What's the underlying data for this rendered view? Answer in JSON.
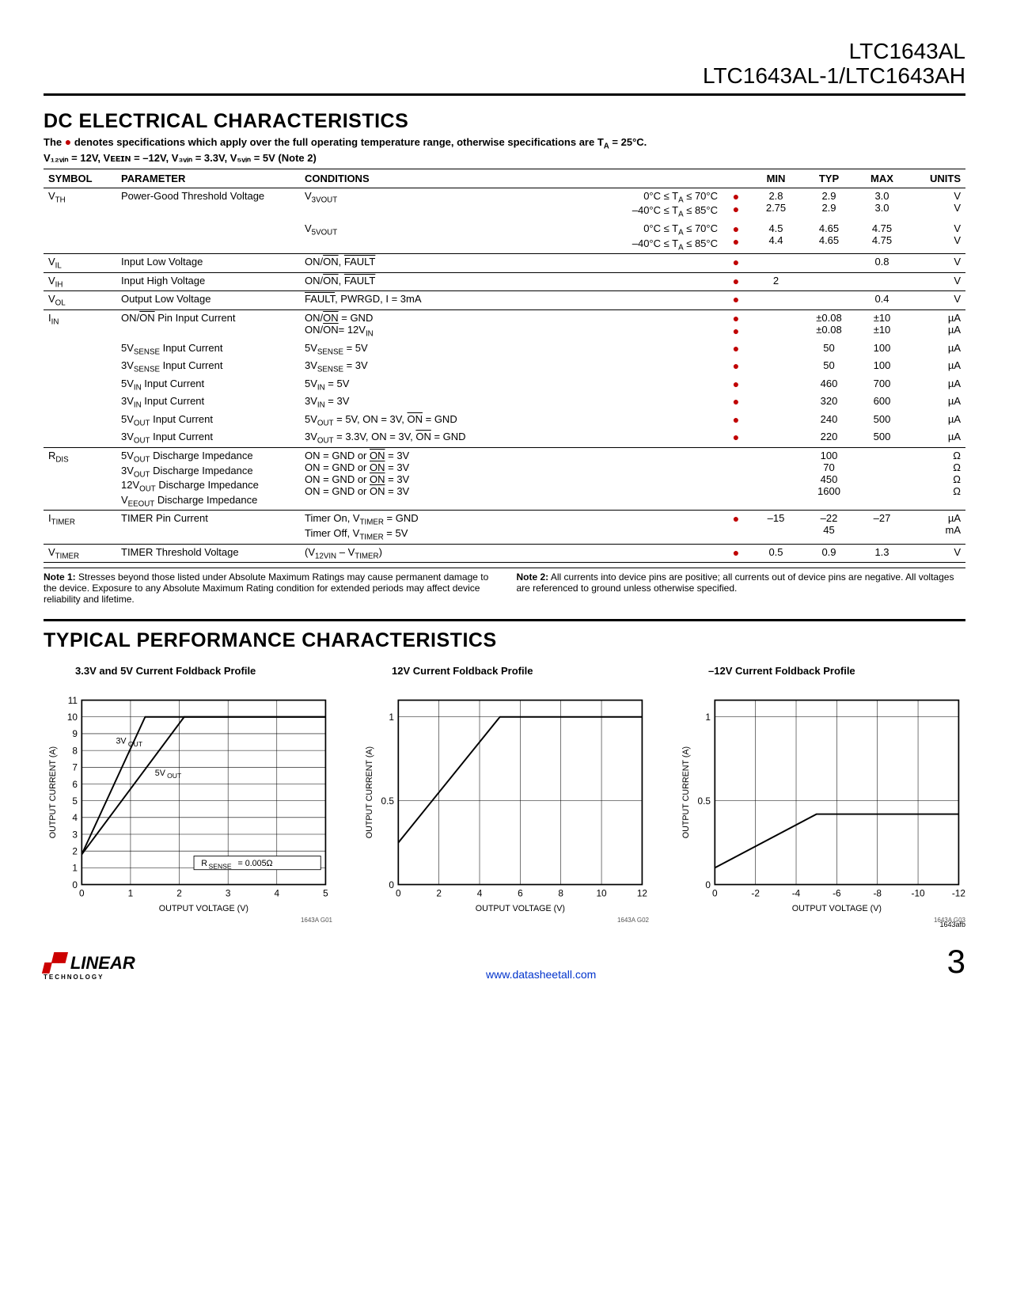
{
  "header": {
    "line1": "LTC1643AL",
    "line2": "LTC1643AL-1/LTC1643AH"
  },
  "sec1": {
    "title": "DC ELECTRICAL CHARACTERISTICS",
    "cond_pre": "The ",
    "cond_post": " denotes specifications which apply over the full operating temperature range, otherwise specifications are T",
    "cond_post2": " = 25°C.",
    "cond_line2": "V₁₂ᵥᵢₙ = 12V, Vᴇᴇɪɴ = –12V, V₃ᵥᵢₙ = 3.3V, V₅ᵥᵢₙ = 5V (Note 2)"
  },
  "tbl": {
    "h_symbol": "SYMBOL",
    "h_param": "PARAMETER",
    "h_cond": "CONDITIONS",
    "h_min": "MIN",
    "h_typ": "TYP",
    "h_max": "MAX",
    "h_units": "UNITS"
  },
  "rows": [
    {
      "sym": "V<sub>TH</sub>",
      "param": "Power-Good Threshold Voltage",
      "cond": "V<sub>3VOUT</sub>",
      "cond2": "0°C ≤ T<sub>A</sub> ≤ 70°C<br>–40°C ≤ T<sub>A</sub> ≤ 85°C",
      "dot": "●<br>●",
      "min": "2.8<br>2.75",
      "typ": "2.9<br>2.9",
      "max": "3.0<br>3.0",
      "u": "V<br>V"
    },
    {
      "cont": true,
      "cond": "V<sub>5VOUT</sub>",
      "cond2": "0°C ≤ T<sub>A</sub> ≤ 70°C<br>–40°C ≤ T<sub>A</sub> ≤ 85°C",
      "dot": "●<br>●",
      "min": "4.5<br>4.4",
      "typ": "4.65<br>4.65",
      "max": "4.75<br>4.75",
      "u": "V<br>V"
    },
    {
      "sym": "V<sub>IL</sub>",
      "param": "Input Low Voltage",
      "cond": "ON/<span class='ov'>ON</span>, <span class='ov'>FAULT</span>",
      "dot": "●",
      "max": "0.8",
      "u": "V"
    },
    {
      "sym": "V<sub>IH</sub>",
      "param": "Input High Voltage",
      "cond": "ON/<span class='ov'>ON</span>, <span class='ov'>FAULT</span>",
      "dot": "●",
      "min": "2",
      "u": "V"
    },
    {
      "sym": "V<sub>OL</sub>",
      "param": "Output Low Voltage",
      "cond": "<span class='ov'>FAULT</span>, PWRGD, I = 3mA",
      "dot": "●",
      "max": "0.4",
      "u": "V"
    },
    {
      "sym": "I<sub>IN</sub>",
      "param": "ON/<span class='ov'>ON</span> Pin Input Current",
      "cond": "ON/<span class='ov'>ON</span> = GND<br>ON/<span class='ov'>ON</span>= 12V<sub>IN</sub>",
      "dot": "●<br>●",
      "typ": "±0.08<br>±0.08",
      "max": "±10<br>±10",
      "u": "µA<br>µA"
    },
    {
      "cont": true,
      "param": "5V<sub>SENSE</sub> Input Current",
      "cond": "5V<sub>SENSE</sub> = 5V",
      "dot": "●",
      "typ": "50",
      "max": "100",
      "u": "µA"
    },
    {
      "cont": true,
      "param": "3V<sub>SENSE</sub> Input Current",
      "cond": "3V<sub>SENSE</sub> = 3V",
      "dot": "●",
      "typ": "50",
      "max": "100",
      "u": "µA"
    },
    {
      "cont": true,
      "param": "5V<sub>IN</sub> Input Current",
      "cond": "5V<sub>IN</sub> = 5V",
      "dot": "●",
      "typ": "460",
      "max": "700",
      "u": "µA"
    },
    {
      "cont": true,
      "param": "3V<sub>IN</sub> Input Current",
      "cond": "3V<sub>IN</sub> = 3V",
      "dot": "●",
      "typ": "320",
      "max": "600",
      "u": "µA"
    },
    {
      "cont": true,
      "param": "5V<sub>OUT</sub> Input Current",
      "cond": "5V<sub>OUT</sub> = 5V, ON = 3V, <span class='ov'>ON</span> = GND",
      "dot": "●",
      "typ": "240",
      "max": "500",
      "u": "µA"
    },
    {
      "cont": true,
      "param": "3V<sub>OUT</sub> Input Current",
      "cond": "3V<sub>OUT</sub> = 3.3V, ON = 3V, <span class='ov'>ON</span> = GND",
      "dot": "●",
      "typ": "220",
      "max": "500",
      "u": "µA"
    },
    {
      "sym": "R<sub>DIS</sub>",
      "param": "5V<sub>OUT</sub> Discharge Impedance<br>3V<sub>OUT</sub> Discharge Impedance<br>12V<sub>OUT</sub> Discharge Impedance<br>V<sub>EEOUT</sub> Discharge Impedance",
      "cond": "ON = GND or <span class='ov'>ON</span> = 3V<br>ON = GND or <span class='ov'>ON</span> = 3V<br>ON = GND or <span class='ov'>ON</span> = 3V<br>ON = GND or <span class='ov'>ON</span> = 3V",
      "typ": "100<br>70<br>450<br>1600",
      "u": "Ω<br>Ω<br>Ω<br>Ω"
    },
    {
      "sym": "I<sub>TIMER</sub>",
      "param": "TIMER Pin Current",
      "cond": "Timer On, V<sub>TIMER</sub> = GND<br>Timer Off, V<sub>TIMER</sub> = 5V",
      "dot": "●",
      "min": "–15",
      "typ": "–22<br>45",
      "max": "–27",
      "u": "µA<br>mA"
    },
    {
      "sym": "V<sub>TIMER</sub>",
      "param": "TIMER Threshold Voltage",
      "cond": "(V<sub>12VIN</sub> – V<sub>TIMER</sub>)",
      "dot": "●",
      "min": "0.5",
      "typ": "0.9",
      "max": "1.3",
      "u": "V"
    }
  ],
  "notes": {
    "n1_b": "Note 1:",
    "n1": " Stresses beyond those listed under Absolute Maximum Ratings may cause permanent damage to the device. Exposure to any Absolute Maximum Rating condition for extended periods may affect device reliability and lifetime.",
    "n2_b": "Note 2:",
    "n2": " All currents into device pins are positive; all currents out of device pins are negative. All voltages are referenced to ground unless otherwise specified."
  },
  "sec2": {
    "title": "TYPICAL PERFORMANCE CHARACTERISTICS"
  },
  "chart_data": [
    {
      "type": "line",
      "title": "3.3V and 5V Current Foldback Profile",
      "xlabel": "OUTPUT VOLTAGE (V)",
      "ylabel": "OUTPUT CURRENT (A)",
      "x_ticks": [
        0,
        1,
        2,
        3,
        4,
        5
      ],
      "y_ticks": [
        0,
        1,
        2,
        3,
        4,
        5,
        6,
        7,
        8,
        9,
        10,
        11
      ],
      "xlim": [
        0,
        5
      ],
      "ylim": [
        0,
        11
      ],
      "annotations": [
        "3V<sub>OUT</sub>",
        "5V<sub>OUT</sub>",
        "R<sub>SENSE</sub> = 0.005Ω"
      ],
      "series": [
        {
          "name": "3VOUT",
          "x": [
            0,
            1.3,
            5
          ],
          "y": [
            1.8,
            10,
            10
          ]
        },
        {
          "name": "5VOUT",
          "x": [
            0,
            2.1,
            5
          ],
          "y": [
            1.8,
            10,
            10
          ]
        }
      ],
      "code": "1643A G01"
    },
    {
      "type": "line",
      "title": "12V Current Foldback Profile",
      "xlabel": "OUTPUT VOLTAGE (V)",
      "ylabel": "OUTPUT CURRENT (A)",
      "x_ticks": [
        0,
        2,
        4,
        6,
        8,
        10,
        12
      ],
      "y_ticks": [
        0,
        0.5,
        1.0
      ],
      "xlim": [
        0,
        12
      ],
      "ylim": [
        0,
        1.1
      ],
      "series": [
        {
          "name": "12V",
          "x": [
            0,
            5,
            12
          ],
          "y": [
            0.25,
            1.0,
            1.0
          ]
        }
      ],
      "code": "1643A G02"
    },
    {
      "type": "line",
      "title": "–12V Current Foldback Profile",
      "xlabel": "OUTPUT VOLTAGE (V)",
      "ylabel": "OUTPUT CURRENT (A)",
      "x_ticks": [
        0,
        -2,
        -4,
        -6,
        -8,
        -10,
        -12
      ],
      "y_ticks": [
        0,
        0.5,
        1.0
      ],
      "xlim": [
        0,
        -12
      ],
      "ylim": [
        0,
        1.1
      ],
      "series": [
        {
          "name": "-12V",
          "x": [
            0,
            -5,
            -12
          ],
          "y": [
            0.1,
            0.42,
            0.42
          ]
        }
      ],
      "code": "1643A G03"
    }
  ],
  "footer": {
    "logo1": "LINEAR",
    "logo2": "TECHNOLOGY",
    "url": "www.datasheetall.com",
    "rev": "1643afb",
    "page": "3"
  }
}
